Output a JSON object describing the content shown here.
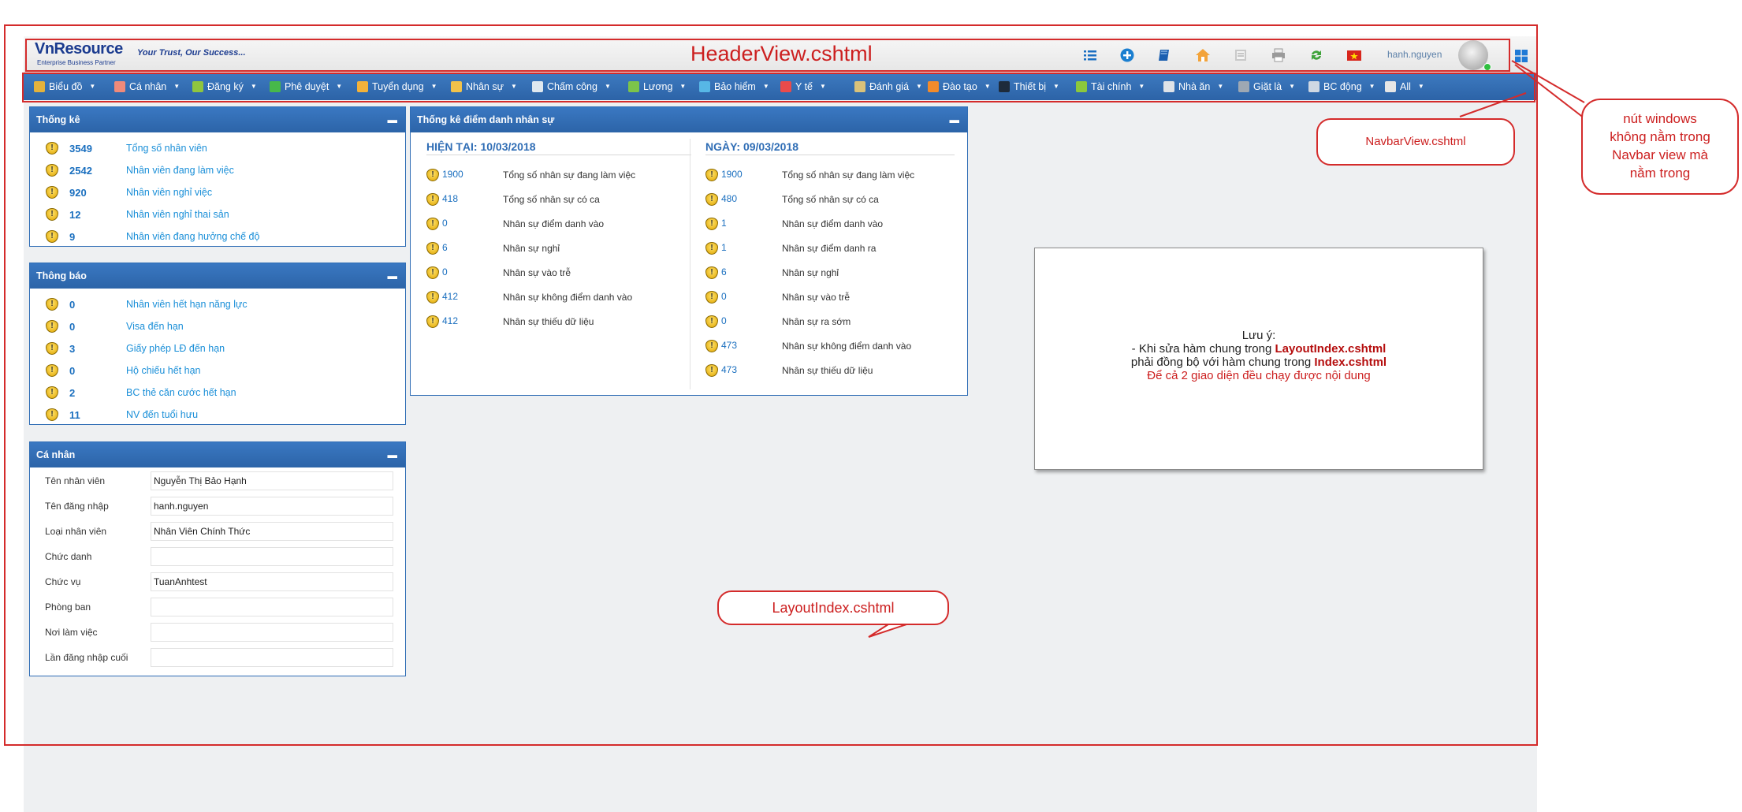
{
  "header": {
    "logo": "VnResource",
    "logo_sub": "Enterprise Business Partner",
    "slogan": "Your Trust, Our Success...",
    "title": "HeaderView.cshtml",
    "username": "hanh.nguyen",
    "icons": [
      "list-icon",
      "plus-circle-icon",
      "book-icon",
      "home-icon",
      "document-icon",
      "printer-icon",
      "recycle-icon",
      "vietnam-flag-icon",
      "avatar",
      "windows-icon"
    ]
  },
  "navbar": {
    "items": [
      {
        "label": "Biểu đồ",
        "icon": "chart-icon",
        "color": "#e3b23c"
      },
      {
        "label": "Cá nhân",
        "icon": "person-icon",
        "color": "#f08a7a"
      },
      {
        "label": "Đăng ký",
        "icon": "plus-icon",
        "color": "#8fc63f"
      },
      {
        "label": "Phê duyệt",
        "icon": "check-icon",
        "color": "#47b84a"
      },
      {
        "label": "Tuyển dụng",
        "icon": "people-icon",
        "color": "#f3b23a"
      },
      {
        "label": "Nhân sự",
        "icon": "staff-icon",
        "color": "#f1c24b"
      },
      {
        "label": "Chấm công",
        "icon": "clock-icon",
        "color": "#dfe8ef"
      },
      {
        "label": "Lương",
        "icon": "money-icon",
        "color": "#7cc44a"
      },
      {
        "label": "Bảo hiểm",
        "icon": "globe-icon",
        "color": "#57b7e6"
      },
      {
        "label": "Y tế",
        "icon": "medical-icon",
        "color": "#e94b4b"
      },
      {
        "label": "Đánh giá",
        "icon": "clipboard-icon",
        "color": "#d9c27a"
      },
      {
        "label": "Đào tạo",
        "icon": "training-icon",
        "color": "#f28b2b"
      },
      {
        "label": "Thiết bị",
        "icon": "monitor-icon",
        "color": "#1e2b3b"
      },
      {
        "label": "Tài chính",
        "icon": "finance-icon",
        "color": "#8cc83c"
      },
      {
        "label": "Nhà ăn",
        "icon": "food-icon",
        "color": "#dfe3e8"
      },
      {
        "label": "Giặt là",
        "icon": "laundry-icon",
        "color": "#9ea8b3"
      },
      {
        "label": "BC động",
        "icon": "report-icon",
        "color": "#cfd8e3"
      },
      {
        "label": "All",
        "icon": "all-icon",
        "color": "#e6e6e6"
      }
    ]
  },
  "thong_ke": {
    "title": "Thống kê",
    "rows": [
      {
        "num": "3549",
        "label": "Tổng số nhân viên"
      },
      {
        "num": "2542",
        "label": "Nhân viên đang làm việc"
      },
      {
        "num": "920",
        "label": "Nhân viên nghỉ việc"
      },
      {
        "num": "12",
        "label": "Nhân viên nghỉ thai sản"
      },
      {
        "num": "9",
        "label": "Nhân viên đang hưởng chế độ"
      }
    ]
  },
  "thong_bao": {
    "title": "Thông báo",
    "rows": [
      {
        "num": "0",
        "label": "Nhân viên hết hạn năng lực"
      },
      {
        "num": "0",
        "label": "Visa đến hạn"
      },
      {
        "num": "3",
        "label": "Giấy phép LĐ đến hạn"
      },
      {
        "num": "0",
        "label": "Hộ chiếu hết hạn"
      },
      {
        "num": "2",
        "label": "BC thẻ căn cước hết hạn"
      },
      {
        "num": "11",
        "label": "NV đến tuổi hưu"
      }
    ]
  },
  "ca_nhan": {
    "title": "Cá nhân",
    "fields": [
      {
        "label": "Tên nhân viên",
        "value": "Nguyễn Thị Bảo Hạnh"
      },
      {
        "label": "Tên đăng nhập",
        "value": "hanh.nguyen"
      },
      {
        "label": "Loại nhân viên",
        "value": "Nhân Viên Chính Thức"
      },
      {
        "label": "Chức danh",
        "value": ""
      },
      {
        "label": "Chức vụ",
        "value": "TuanAnhtest"
      },
      {
        "label": "Phòng ban",
        "value": ""
      },
      {
        "label": "Nơi làm việc",
        "value": ""
      },
      {
        "label": "Lần đăng nhập cuối",
        "value": ""
      }
    ]
  },
  "diem_danh": {
    "title": "Thống kê điểm danh nhân sự",
    "left": {
      "heading": "HIỆN TẠI: 10/03/2018",
      "rows": [
        {
          "num": "1900",
          "label": "Tổng số nhân sự đang làm việc"
        },
        {
          "num": "418",
          "label": "Tổng số nhân sự có ca"
        },
        {
          "num": "0",
          "label": "Nhân sự điểm danh vào"
        },
        {
          "num": "6",
          "label": "Nhân sự nghỉ"
        },
        {
          "num": "0",
          "label": "Nhân sự vào trễ"
        },
        {
          "num": "412",
          "label": "Nhân sự không điểm danh vào"
        },
        {
          "num": "412",
          "label": "Nhân sự thiếu dữ liệu"
        }
      ]
    },
    "right": {
      "heading": "NGÀY: 09/03/2018",
      "rows": [
        {
          "num": "1900",
          "label": "Tổng số nhân sự đang làm việc"
        },
        {
          "num": "480",
          "label": "Tổng số nhân sự có ca"
        },
        {
          "num": "1",
          "label": "Nhân sự điểm danh vào"
        },
        {
          "num": "1",
          "label": "Nhân sự điểm danh ra"
        },
        {
          "num": "6",
          "label": "Nhân sự nghỉ"
        },
        {
          "num": "0",
          "label": "Nhân sự vào trễ"
        },
        {
          "num": "0",
          "label": "Nhân sự ra sớm"
        },
        {
          "num": "473",
          "label": "Nhân sự không điểm danh vào"
        },
        {
          "num": "473",
          "label": "Nhân sự thiếu dữ liệu"
        }
      ]
    }
  },
  "annotations": {
    "navbar_view": "NavbarView.cshtml",
    "layout_index": "LayoutIndex.cshtml",
    "windows_note_lines": [
      "nút windows",
      "không nằm trong",
      "Navbar view mà",
      "nằm trong"
    ]
  },
  "note": {
    "line1": "Lưu ý:",
    "line2_pre": "- Khi sửa hàm chung trong ",
    "line2_file": "LayoutIndex.cshtml",
    "line3_pre": "phải đồng bộ với hàm chung trong ",
    "line3_file": "Index.cshtml",
    "line4": "Để cả 2 giao diện đều chạy được nội dung"
  }
}
